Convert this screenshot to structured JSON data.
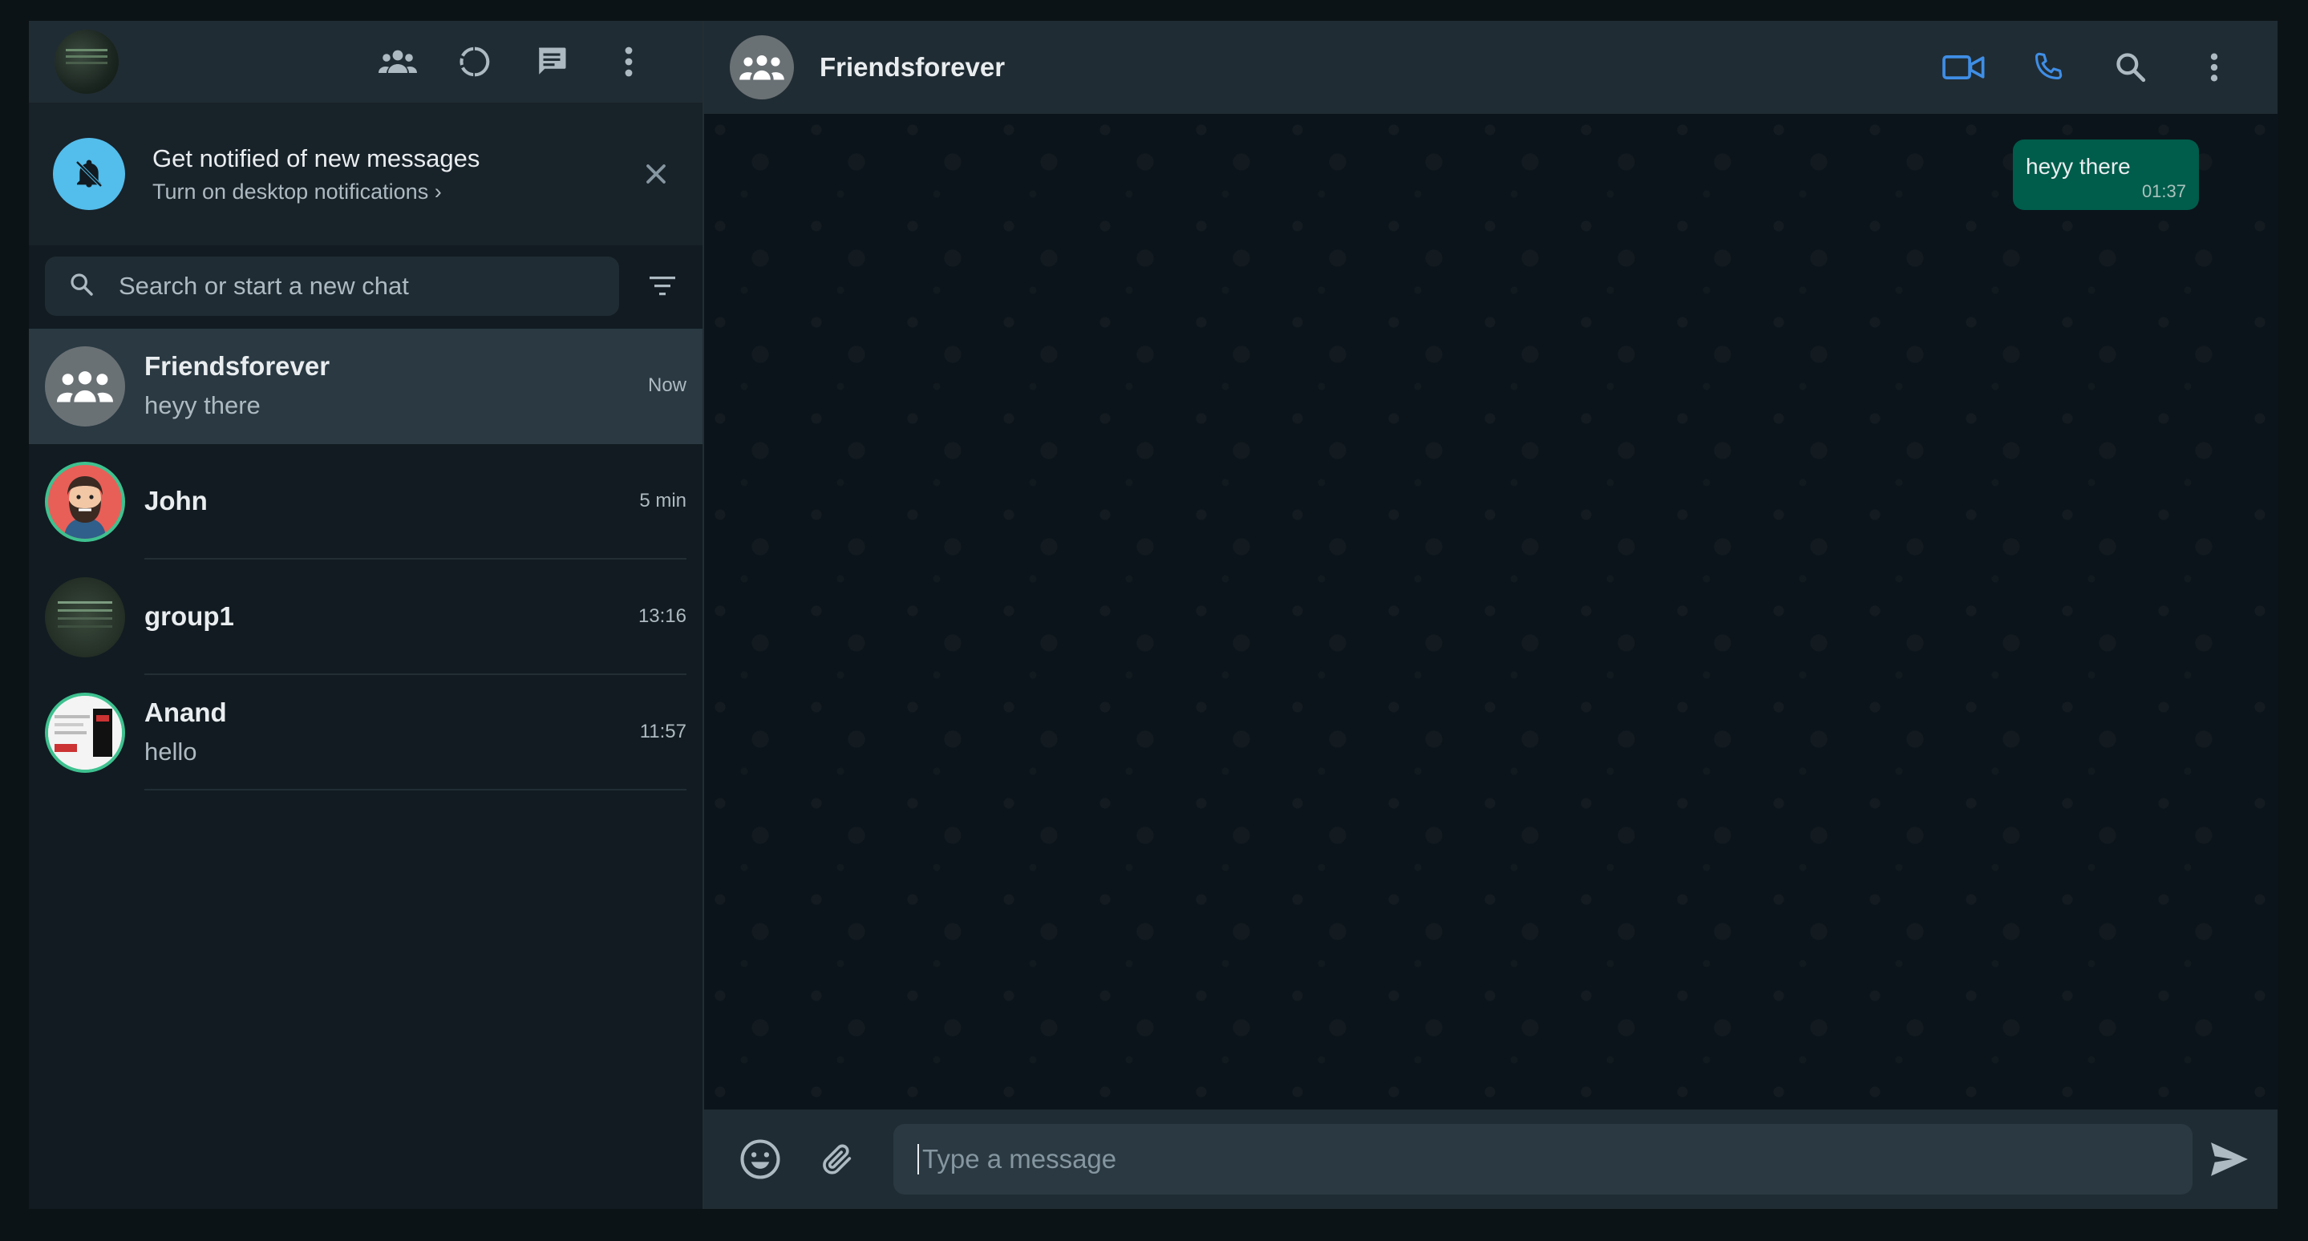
{
  "sidebar": {
    "header": {
      "icons": [
        "communities-icon",
        "status-icon",
        "new-chat-icon",
        "menu-icon"
      ]
    },
    "notification": {
      "title": "Get notified of new messages",
      "subtitle": "Turn on desktop notifications ›"
    },
    "search": {
      "placeholder": "Search or start a new chat"
    },
    "chats": [
      {
        "name": "Friendsforever",
        "preview": "heyy there",
        "time": "Now",
        "active": true
      },
      {
        "name": "John",
        "preview": "",
        "time": "5 min",
        "active": false
      },
      {
        "name": "group1",
        "preview": "",
        "time": "13:16",
        "active": false
      },
      {
        "name": "Anand",
        "preview": "hello",
        "time": "11:57",
        "active": false
      }
    ]
  },
  "conversation": {
    "title": "Friendsforever",
    "icons": [
      "video-call-icon",
      "voice-call-icon",
      "search-icon",
      "menu-icon"
    ],
    "messages": [
      {
        "text": "heyy there",
        "time": "01:37",
        "outgoing": true
      }
    ],
    "composer": {
      "placeholder": "Type a message"
    }
  },
  "colors": {
    "accent": "#00a884",
    "bubble_out": "#005c4b",
    "panel": "#202c33",
    "bg": "#111b21",
    "link_blue": "#53bdeb"
  }
}
